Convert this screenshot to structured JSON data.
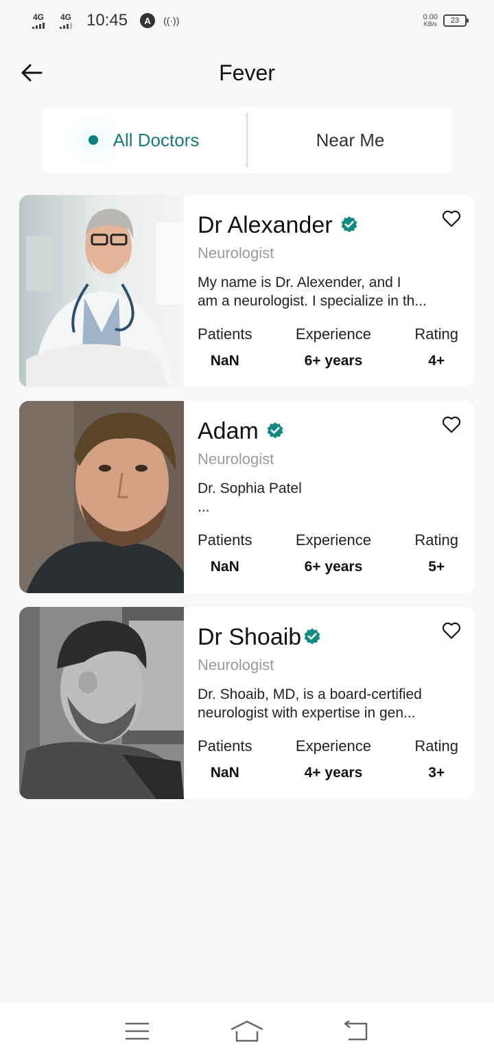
{
  "status_bar": {
    "net1": "4G",
    "net2": "4G",
    "time": "10:45",
    "speed_value": "0.00",
    "speed_unit": "KB/s",
    "battery": "23"
  },
  "header": {
    "title": "Fever"
  },
  "tabs": [
    {
      "label": "All Doctors",
      "active": true
    },
    {
      "label": "Near Me",
      "active": false
    }
  ],
  "stat_labels": {
    "patients": "Patients",
    "experience": "Experience",
    "rating": "Rating"
  },
  "doctors": [
    {
      "name": "Dr Alexander",
      "specialty": "Neurologist",
      "bio_line1": "My name is Dr. Alexender, and I",
      "bio_line2": "am a neurologist. I specialize in th...",
      "patients": "NaN",
      "experience": "6+ years",
      "rating": "4+"
    },
    {
      "name": "Adam",
      "specialty": "Neurologist",
      "bio_line1": "Dr. Sophia Patel",
      "bio_line2": "...",
      "patients": "NaN",
      "experience": "6+ years",
      "rating": "5+"
    },
    {
      "name": "Dr Shoaib",
      "specialty": "Neurologist",
      "bio_line1": "Dr. Shoaib, MD, is a board-certified",
      "bio_line2": "neurologist with expertise in gen...",
      "patients": "NaN",
      "experience": "4+ years",
      "rating": "3+"
    }
  ],
  "colors": {
    "accent": "#0f7f7f",
    "verified": "#148a84",
    "background": "#f7f7f7"
  },
  "icons": [
    "back-arrow-icon",
    "verified-badge-icon",
    "heart-outline-icon",
    "menu-icon",
    "home-icon",
    "back-nav-icon"
  ]
}
